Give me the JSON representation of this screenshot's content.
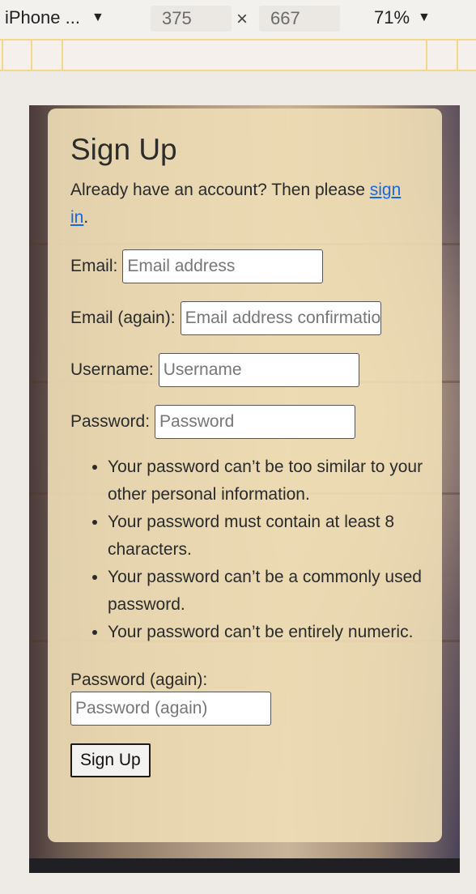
{
  "devtools": {
    "device": "iPhone ...",
    "width": "375",
    "times": "×",
    "height": "667",
    "zoom": "71%",
    "dropdown_arrow": "▼"
  },
  "form": {
    "title": "Sign Up",
    "intro_text": "Already have an account? Then please",
    "signin_link": "sign in",
    "intro_end": ".",
    "email_label": "Email:",
    "email_placeholder": "Email address",
    "email2_label": "Email (again):",
    "email2_placeholder": "Email address confirmation",
    "username_label": "Username:",
    "username_placeholder": "Username",
    "password_label": "Password:",
    "password_placeholder": "Password",
    "password_help": [
      "Your password can’t be too similar to your other personal information.",
      "Your password must contain at least 8 characters.",
      "Your password can’t be a commonly used password.",
      "Your password can’t be entirely numeric."
    ],
    "password2_label": "Password (again):",
    "password2_placeholder": "Password (again)",
    "submit_label": "Sign Up"
  },
  "colors": {
    "link": "#1a66e0",
    "card": "#eedeb6",
    "page_bg": "#eeeae5"
  }
}
